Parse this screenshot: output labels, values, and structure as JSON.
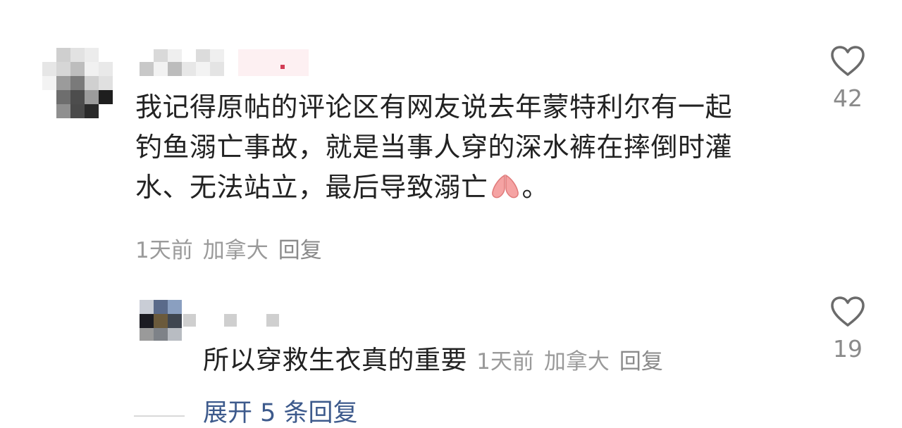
{
  "comment": {
    "text_lines": [
      "我记得原帖的评论区有网友说去年蒙特利尔有一起",
      "钓鱼溺亡事故，就是当事人穿的深水裤在摔倒时灌",
      "水、无法站立，最后导致溺亡"
    ],
    "text_end": "。",
    "emoji_icon": "praying-hands-icon",
    "time": "1天前",
    "location": "加拿大",
    "reply_label": "回复",
    "likes": "42"
  },
  "reply": {
    "text": "所以穿救生衣真的重要",
    "time": "1天前",
    "location": "加拿大",
    "reply_label": "回复",
    "likes": "19"
  },
  "expand": {
    "label": "展开 5 条回复"
  },
  "colors": {
    "text": "#222222",
    "meta": "#9a9a9a",
    "link": "#3d5a8c",
    "heart_stroke": "#6b6b6b",
    "emoji": "#f08080"
  }
}
